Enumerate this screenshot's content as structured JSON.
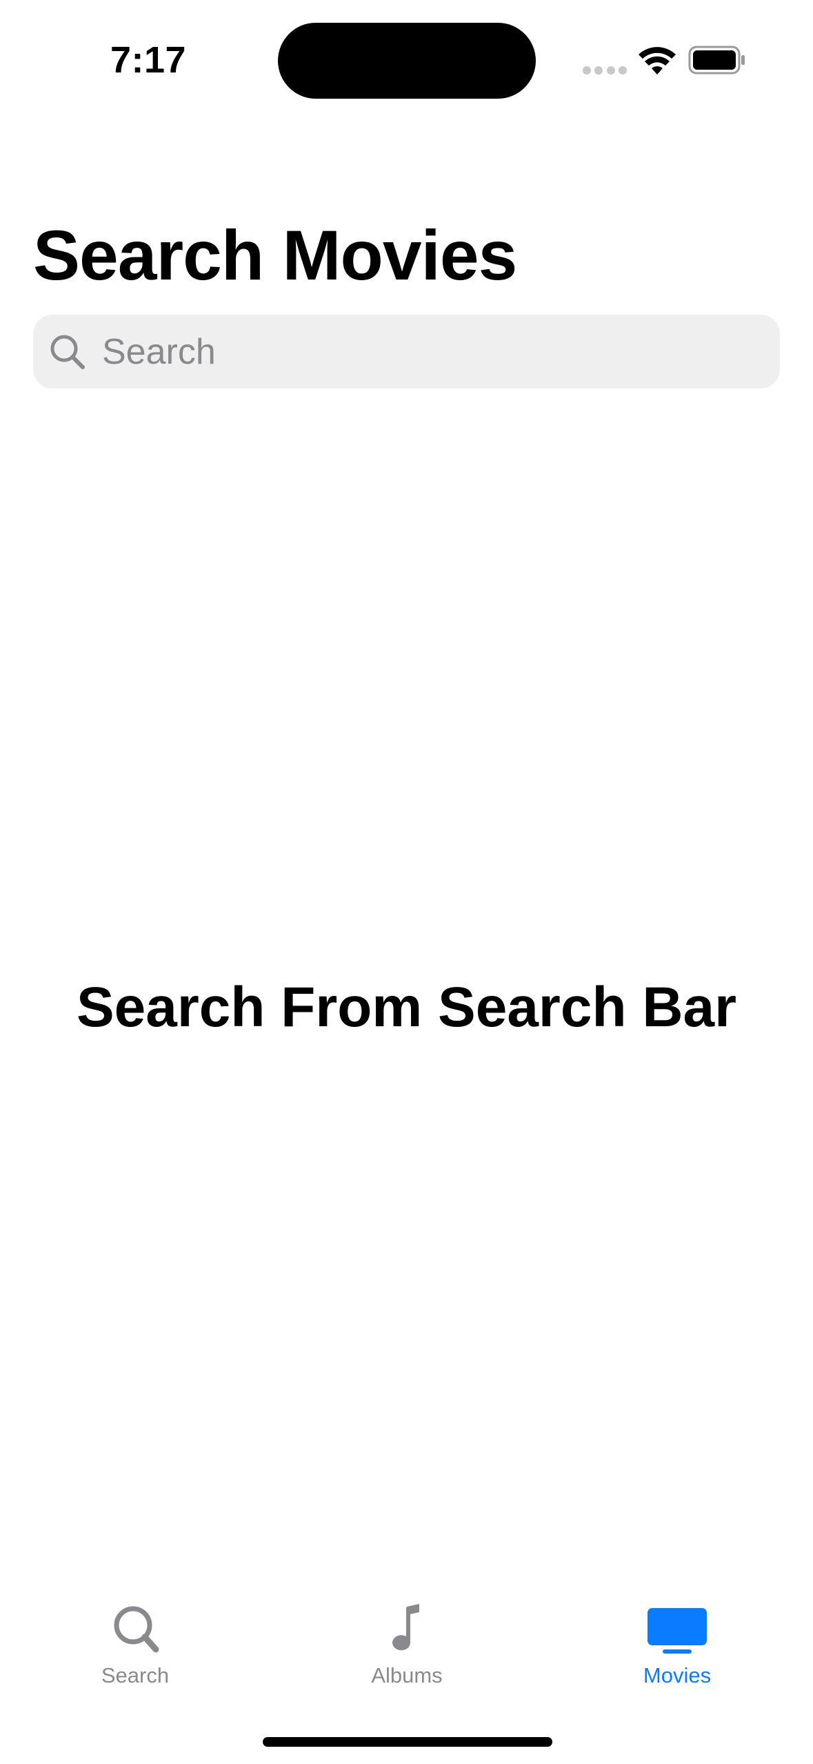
{
  "status_bar": {
    "time": "7:17",
    "wifi_icon": "wifi-icon",
    "battery_icon": "battery-full-icon"
  },
  "page": {
    "title": "Search Movies"
  },
  "search": {
    "placeholder": "Search",
    "value": "",
    "icon": "magnifying-glass-icon"
  },
  "empty_state": {
    "message": "Search From Search Bar"
  },
  "tab_bar": {
    "active": "Movies",
    "accent_color": "#0a7cff",
    "inactive_color": "#8a8a8e",
    "tabs": [
      {
        "label": "Search",
        "icon": "magnifying-glass-icon"
      },
      {
        "label": "Albums",
        "icon": "music-note-icon"
      },
      {
        "label": "Movies",
        "icon": "tv-icon"
      }
    ]
  }
}
